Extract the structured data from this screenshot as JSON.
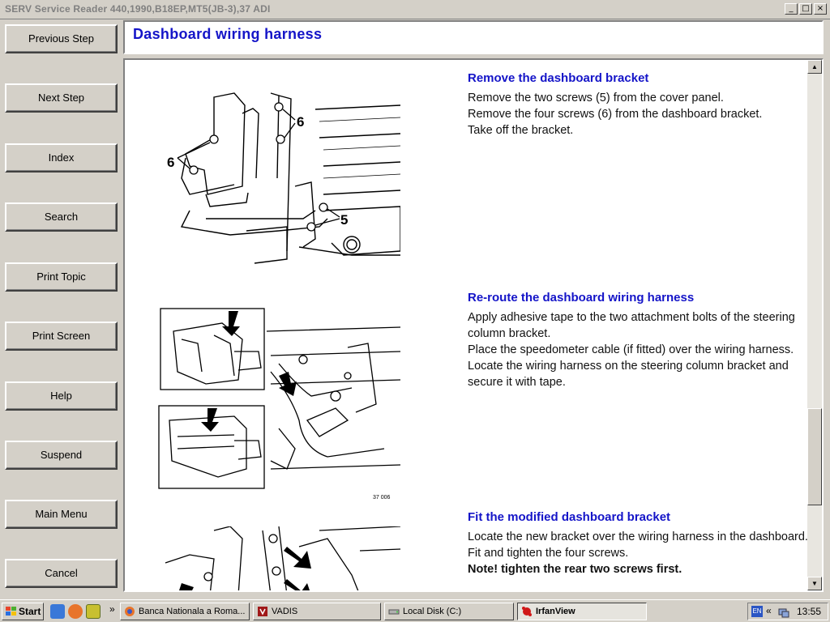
{
  "window": {
    "title": "SERV Service Reader 440,1990,B18EP,MT5(JB-3),37 ADI",
    "min": "_",
    "max": "□",
    "close": "×"
  },
  "nav": {
    "previous_step": "Previous Step",
    "next_step": "Next Step",
    "index": "Index",
    "search": "Search",
    "print_topic": "Print Topic",
    "print_screen": "Print Screen",
    "help": "Help",
    "suspend": "Suspend",
    "main_menu": "Main Menu",
    "cancel": "Cancel"
  },
  "header": {
    "title": "Dashboard wiring harness"
  },
  "steps": [
    {
      "heading": "Remove the dashboard bracket",
      "lines": [
        "Remove the two screws (5) from the cover panel.",
        "Remove the four screws (6) from the dashboard bracket.",
        "Take off the bracket."
      ]
    },
    {
      "heading": "Re-route the dashboard wiring harness",
      "lines": [
        "Apply adhesive tape to the two attachment bolts of the steering column bracket.",
        "Place the speedometer cable (if fitted) over the wiring harness.",
        "Locate the wiring harness on the steering column bracket and secure it with tape."
      ]
    },
    {
      "heading": "Fit the modified dashboard bracket",
      "lines": [
        "Locate the new bracket over the wiring harness in the dashboard.",
        "Fit and tighten the four screws.",
        "Note! tighten the rear two screws first."
      ]
    }
  ],
  "figures": {
    "fig1_labels": [
      "6",
      "6",
      "5"
    ],
    "fig2_code": "37 006"
  },
  "taskbar": {
    "start": "Start",
    "tasks": [
      "Banca Nationala a Roma...",
      "VADIS",
      "Local Disk (C:)",
      "IrfanView"
    ],
    "lang": "EN",
    "clock": "13:55"
  },
  "colors": {
    "heading_blue": "#1414c8",
    "chrome": "#d4d0c8"
  }
}
